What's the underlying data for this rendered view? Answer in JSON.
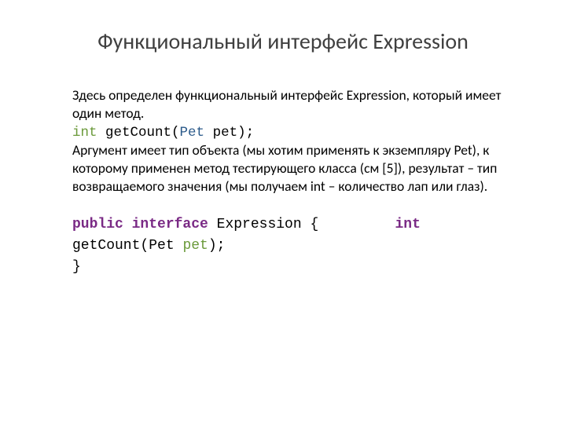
{
  "title": "Функциональный интерфейс Expression",
  "para1": "Здесь определен функциональный интерфейс Expression, который имеет один метод.",
  "code1": {
    "int": "int",
    "getCount": " getCount(",
    "pet": "Pet",
    "rest": " pet);"
  },
  "para2": "Аргумент имеет тип объекта (мы хотим применять к экземпляру Pet), к которому применен метод тестирующего класса (см [5]), результат – тип возвращаемого значения (мы получаем int – количество лап или глаз).",
  "code2": {
    "line1": {
      "public": "public",
      "sp1": " ",
      "interface": "interface",
      "mid": " Expression {",
      "gap": "         ",
      "int": "int"
    },
    "line2": {
      "getCount": "getCount(Pet ",
      "pet": "pet",
      "rest": ");"
    },
    "line3": "}"
  }
}
